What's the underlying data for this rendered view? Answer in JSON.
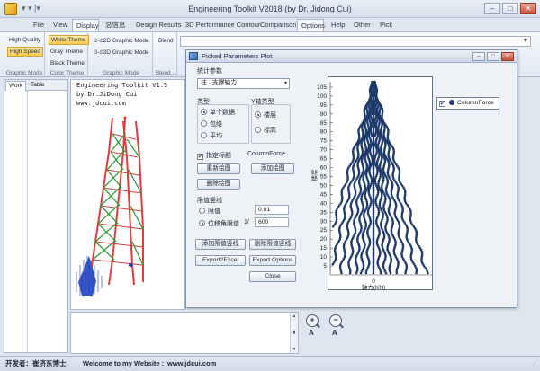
{
  "window": {
    "title": "Engineering Toolkit V2018 (by Dr. Jidong Cui)",
    "qat": "▾ ▾ |▾"
  },
  "menu": {
    "tabs": [
      {
        "label": "File"
      },
      {
        "label": "View"
      },
      {
        "label": "Display"
      },
      {
        "label": "总信息"
      },
      {
        "label": "Design Results"
      },
      {
        "label": "3D Performance Contour"
      },
      {
        "label": "Comparison"
      },
      {
        "label": "Options"
      },
      {
        "label": "Help"
      },
      {
        "label": "Other"
      },
      {
        "label": "Pick"
      }
    ]
  },
  "ribbon": {
    "graphic_mode": {
      "high_quality": "High Quality",
      "high_speed": "High Speed",
      "label": "Graphic Mode"
    },
    "color_theme": {
      "white": "White Theme",
      "gray": "Gray Theme",
      "black": "Black Theme",
      "label": "Color Theme"
    },
    "graphic_mode2": {
      "mode2d": "2D Graphic Mode",
      "mode3d": "3D Graphic Mode",
      "prefix2d": "2-d",
      "prefix3d": "3-d",
      "label": "Graphic Mode"
    },
    "blend": {
      "label": "Blend",
      "group": "Blend..."
    }
  },
  "left_panel": {
    "tabs": [
      {
        "label": "Work"
      },
      {
        "label": "Table"
      }
    ]
  },
  "canvas": {
    "lines": [
      "Engineering Toolkit V1.3",
      "by Dr.JiDong Cui",
      "www.jdcui.com"
    ]
  },
  "status": {
    "developer": "开发者：崔济东博士",
    "welcome": "Welcome to my Website :",
    "website": "www.jdcui.com"
  },
  "dialog": {
    "title": "Picked Parameters Plot",
    "stat_label": "统计参数",
    "stat_value": "柱 - 支撑轴力",
    "type_label": "类型",
    "type_options": [
      {
        "label": "单个数据",
        "selected": true
      },
      {
        "label": "包络",
        "selected": false
      },
      {
        "label": "平均",
        "selected": false
      }
    ],
    "yaxis_label": "Y轴类型",
    "yaxis_options": [
      {
        "label": "楼层",
        "selected": true
      },
      {
        "label": "标高",
        "selected": false
      }
    ],
    "title_check_label": "指定标题",
    "title_check_checked": true,
    "title_value": "ColumnForce",
    "btn_redraw": "重新绘图",
    "btn_add_plot": "添加绘图",
    "btn_delete_plot": "删除绘图",
    "limit_label": "限值竖线",
    "limit_options": [
      {
        "label": "限值",
        "selected": false,
        "value": "0.01"
      },
      {
        "label": "位移角限值",
        "selected": true,
        "prefix": "1/",
        "value": "600"
      }
    ],
    "btn_add_limit": "添加限值竖线",
    "btn_delete_limit": "删除限值竖线",
    "btn_export_excel": "Export2Excel",
    "btn_export_options": "Export Options",
    "btn_close": "Close",
    "legend_check": "✔",
    "legend_label": "ColumnForce"
  },
  "chart_data": {
    "type": "scatter",
    "series": [
      {
        "name": "ColumnForce",
        "color": "#1d3a6b"
      }
    ],
    "xlabel": "轴力(KN)",
    "ylabel": "楼层",
    "xticks": [
      "0"
    ],
    "yticks": [
      5,
      10,
      15,
      20,
      25,
      30,
      35,
      40,
      45,
      50,
      55,
      60,
      65,
      70,
      75,
      80,
      85,
      90,
      95,
      100,
      105
    ],
    "ylim": [
      0,
      108
    ],
    "grid": false,
    "legend": "right"
  }
}
